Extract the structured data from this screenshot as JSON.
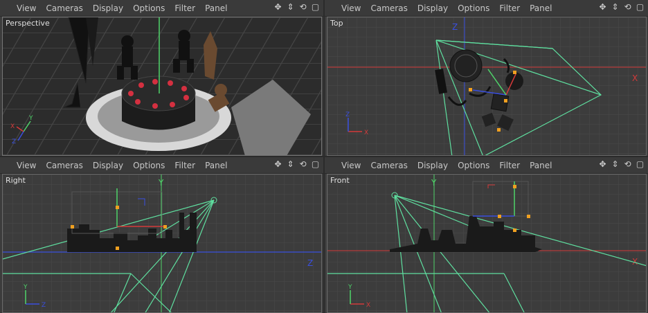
{
  "menu": [
    "View",
    "Cameras",
    "Display",
    "Options",
    "Filter",
    "Panel"
  ],
  "toolbar_icons": [
    "move-icon",
    "dolly-icon",
    "rotate-icon",
    "maximize-icon"
  ],
  "viewports": {
    "perspective": "Perspective",
    "top": "Top",
    "right": "Right",
    "front": "Front"
  },
  "axes": {
    "x": "X",
    "y": "Y",
    "z": "Z"
  },
  "colors": {
    "x_axis": "#d43a3a",
    "y_axis": "#4fd46a",
    "z_axis": "#3a4fe0",
    "camera": "#5fe0a0",
    "handle": "#f0a020"
  }
}
